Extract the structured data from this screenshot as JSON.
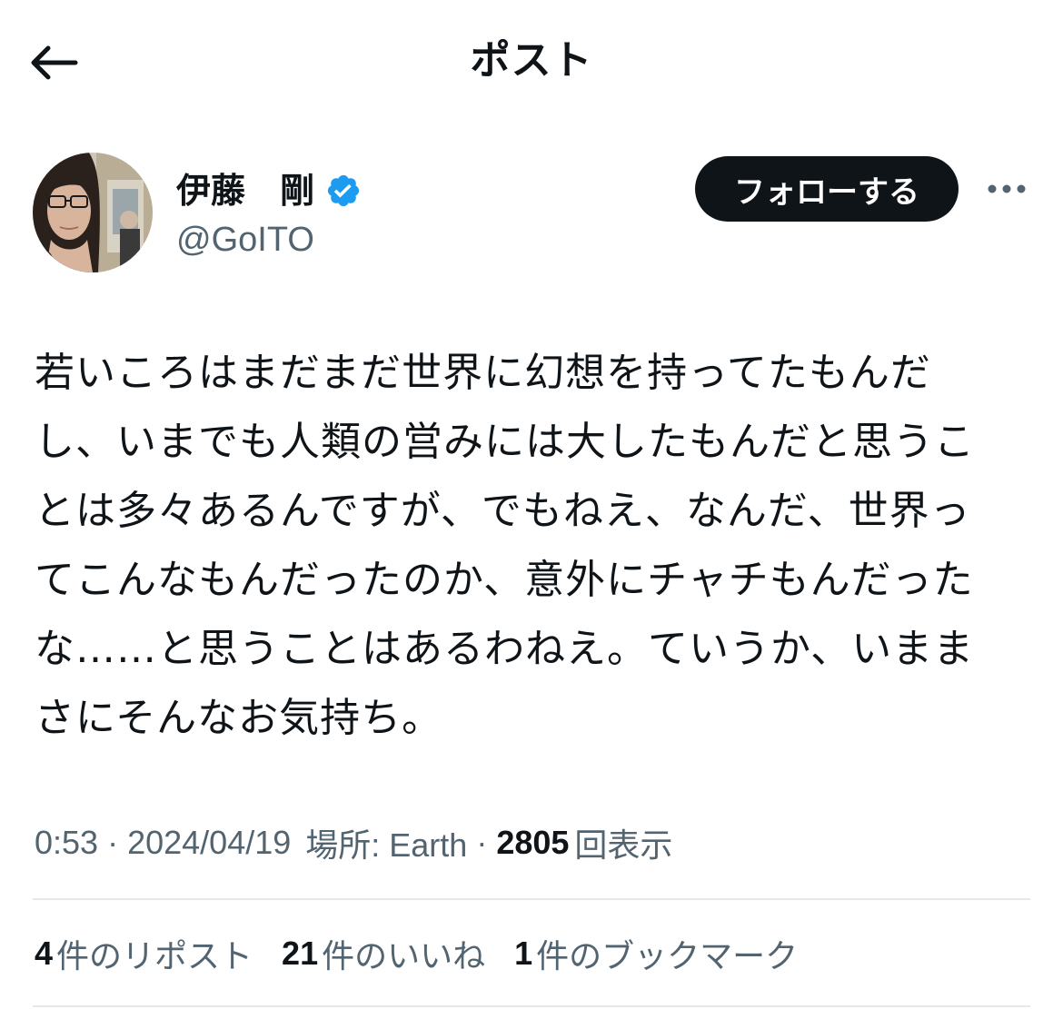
{
  "header": {
    "title": "ポスト",
    "back_icon": "arrow-left-icon"
  },
  "author": {
    "display_name": "伊藤　剛",
    "handle": "@GoITO",
    "verified": true,
    "verified_color": "#1d9bf0",
    "follow_label": "フォローする",
    "more_icon": "more-horizontal-icon"
  },
  "post": {
    "lines": [
      "若いころはまだまだ世界に幻想を持ってたもんだ",
      "し、いまでも人類の営みには大したもんだと思うこ",
      "とは多々あるんですが、でもねえ、なんだ、世界っ",
      "てこんなもんだったのか、意外にチャチもんだった",
      "な……と思うことはあるわねえ。ていうか、いまま",
      "さにそんなお気持ち。"
    ]
  },
  "meta": {
    "time": "0:53",
    "separator": "·",
    "date": "2024/04/19",
    "location": "場所: Earth",
    "views_count": "2805",
    "views_label": "回表示"
  },
  "stats": [
    {
      "count": "4",
      "label": "件のリポスト"
    },
    {
      "count": "21",
      "label": "件のいいね"
    },
    {
      "count": "1",
      "label": "件のブックマーク"
    }
  ],
  "colors": {
    "text_primary": "#0f1419",
    "text_secondary": "#536471",
    "divider": "#e6e9eb",
    "follow_button_bg": "#0f1419"
  }
}
